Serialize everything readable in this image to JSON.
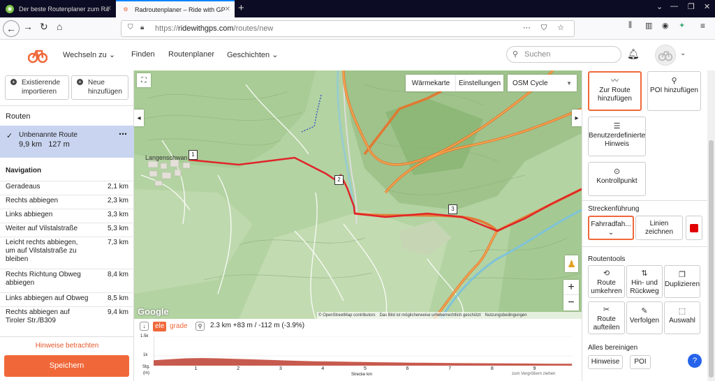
{
  "browser": {
    "tabs": [
      {
        "title": "Der beste Routenplaner zum Ra"
      },
      {
        "title": "Radroutenplaner – Ride with GP"
      }
    ],
    "url_prefix": "https://",
    "url_host": "ridewithgps.com",
    "url_path": "/routes/new"
  },
  "header": {
    "nav": [
      "Wechseln zu",
      "Finden",
      "Routenplaner",
      "Geschichten"
    ],
    "search_placeholder": "Suchen"
  },
  "left": {
    "import_label": "Existierende importieren",
    "new_label": "Neue hinzufügen",
    "routes_header": "Routen",
    "route": {
      "name": "Unbenannte Route",
      "distance": "9,9 km",
      "elevation": "127 m"
    },
    "navigation_header": "Navigation",
    "nav_rows": [
      {
        "instruction": "Geradeaus",
        "km": "2,1 km"
      },
      {
        "instruction": "Rechts abbiegen",
        "km": "2,3 km"
      },
      {
        "instruction": "Links abbiegen",
        "km": "3,3 km"
      },
      {
        "instruction": "Weiter auf Vilstalstraße",
        "km": "5,3 km"
      },
      {
        "instruction": "Leicht rechts abbiegen, um auf Vilstalstraße zu bleiben",
        "km": "7,3 km"
      },
      {
        "instruction": "Rechts Richtung Obweg abbiegen",
        "km": "8,4 km"
      },
      {
        "instruction": "Links abbiegen auf Obweg",
        "km": "8,5 km"
      },
      {
        "instruction": "Rechts abbiegen auf Tiroler Str./B309",
        "km": "9,4 km"
      }
    ],
    "hints_link": "Hinweise betrachten",
    "save_label": "Speichern"
  },
  "map": {
    "heatmap_label": "Wärmekarte",
    "settings_label": "Einstellungen",
    "layer_select": "OSM Cycle",
    "town_label": "Langenschwan",
    "markers": [
      "1",
      "2",
      "3"
    ],
    "google": "Google",
    "attribution": [
      "© OpenStreetMap contributors",
      "Das Bild ist möglicherweise urheberrechtlich geschützt",
      "Nutzungsbedingungen"
    ]
  },
  "elevation": {
    "tab_ele": "ele",
    "tab_grade": "grade",
    "stats": "2.3 km +83 m / -112 m (-3.9%)",
    "y_labels": [
      "1.5k",
      "1k"
    ],
    "x_ticks": [
      "1",
      "2",
      "3",
      "4",
      "5",
      "6",
      "7",
      "8",
      "9"
    ],
    "y_title_1": "Stg.",
    "y_title_2": "(m)",
    "x_title": "Strecke km",
    "zoom_hint": "zum Vergrößern ziehen",
    "profile_m": [
      1010,
      1030,
      1050,
      1055,
      1050,
      1040,
      1030,
      1020,
      1008,
      998,
      990,
      985,
      980,
      975,
      970,
      966,
      962,
      958,
      955,
      952,
      950,
      948,
      946,
      944,
      942,
      940,
      938
    ]
  },
  "right": {
    "add_route_label": "Zur Route hinzufügen",
    "poi_add_label": "POI hinzufügen",
    "custom_hint_label": "Benutzerdefinierter Hinweis",
    "checkpoint_label": "Kontrollpunkt",
    "routing_header": "Streckenführung",
    "mode_label": "Fahrradfah...",
    "draw_label": "Linien zeichnen",
    "line_color": "#e00000",
    "tools_header": "Routentools",
    "tools": [
      "Route umkehren",
      "Hin- und Rückweg",
      "Duplizieren",
      "Route aufteilen",
      "Verfolgen",
      "Auswahl"
    ],
    "clear_header": "Alles bereinigen",
    "clear_hints": "Hinweise",
    "clear_poi": "POI"
  }
}
